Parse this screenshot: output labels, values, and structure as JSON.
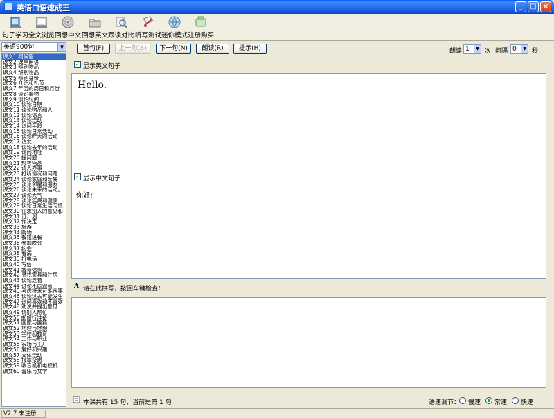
{
  "window": {
    "title": "英语口语速成王"
  },
  "toolbar": {
    "buttons": [
      {
        "label": "句子学习",
        "icon": "sentence-study-icon"
      },
      {
        "label": "全文浏览",
        "icon": "fulltext-browse-icon"
      },
      {
        "label": "回想中文",
        "icon": "recall-chinese-icon"
      },
      {
        "label": "回想英文",
        "icon": "recall-english-icon"
      },
      {
        "label": "跟读对比",
        "icon": "read-compare-icon"
      },
      {
        "label": "听写测试",
        "icon": "dictation-test-icon"
      },
      {
        "label": "迷你模式",
        "icon": "mini-mode-icon"
      },
      {
        "label": "注册购买",
        "icon": "register-buy-icon"
      }
    ]
  },
  "sidebar": {
    "book": "英语900句",
    "lessons": [
      "课文1 问候语",
      "课文2 课堂用语",
      "课文3 辨别物品",
      "课文4 辨别物品",
      "课文5 辨别身份",
      "课文6 介绍和礼节",
      "课文7 年历的周日和月份",
      "课文8 谈论事物",
      "课文9 谈论时间",
      "课文10 谈论日期",
      "课文11 谈论物品和人",
      "课文12 谈论语言",
      "课文13 谈论活动",
      "课文14 询问年龄",
      "课文15 谈论日常活动",
      "课文16 谈论昨天的活动",
      "课文17 访友",
      "课文18 谈论去年的活动",
      "课文19 询问地址",
      "课文20 提问题",
      "课文21 形容物品",
      "课文22 请人办事",
      "课文23 打听情况和问路",
      "课文24 谈论家庭和亲属",
      "课文25 谈论邻居和朋友",
      "课文26 谈论未来的活动。",
      "课文27 谈论天气",
      "课文28 谈论疾病和健康",
      "课文29 谈论日常生活习惯",
      "课文30 征求别人的意见和",
      "课文31 订计划",
      "课文32 作决定",
      "课文33 旅游",
      "课文34 购物",
      "课文35 餐馆进餐",
      "课文36 参加晚会",
      "课文37 约会",
      "课文38 看病",
      "课文39 打电话",
      "课文40 写信",
      "课文41 教谈体验",
      "课文42 寻找家具和住房",
      "课文43 谈论乏着",
      "课文44 讨论不同观点",
      "课文45 考虑将来可能从事",
      "课文46 谈论过去可能发生",
      "课文47 询问喜欢和不喜欢",
      "课文48 劝说并提出意见",
      "课文49 请别人帮忙",
      "课文50 邮旅行准备",
      "课文51 国家与国籍",
      "课文52 地理与地貌",
      "课文53 学校和教育",
      "课文54 工作与职业",
      "课文55 农场与工厂",
      "课文56 爱好和兴趣",
      "课文57 文体活动",
      "课文58 报章杂志",
      "课文59 收音机和电视机",
      "课文60 音乐与文学"
    ],
    "selected_index": 0
  },
  "nav": {
    "first": "首句(F)",
    "prev": "上一句(B)",
    "next": "下一句(N)",
    "read": "朗读(R)",
    "hint": "提示(H)",
    "read_label": "朗读",
    "read_times": "1",
    "times_unit": "次",
    "interval_label": "间隔",
    "interval_value": "0",
    "seconds_unit": "秒"
  },
  "english": {
    "checkbox_label": "显示英文句子",
    "checked": true,
    "sentence": "Hello."
  },
  "chinese": {
    "checkbox_label": "显示中文句子",
    "checked": true,
    "sentence": "你好!"
  },
  "input": {
    "prompt": "请在此拼写，按回车键检查：",
    "value": ""
  },
  "footer": {
    "info": "本课共有 15 句，当前是第 1 句",
    "speed_label": "语速调节：",
    "speeds": [
      {
        "label": "慢速",
        "selected": false
      },
      {
        "label": "常速",
        "selected": true
      },
      {
        "label": "快速",
        "selected": false
      }
    ]
  },
  "status": {
    "text": "V2.7 未注册"
  }
}
